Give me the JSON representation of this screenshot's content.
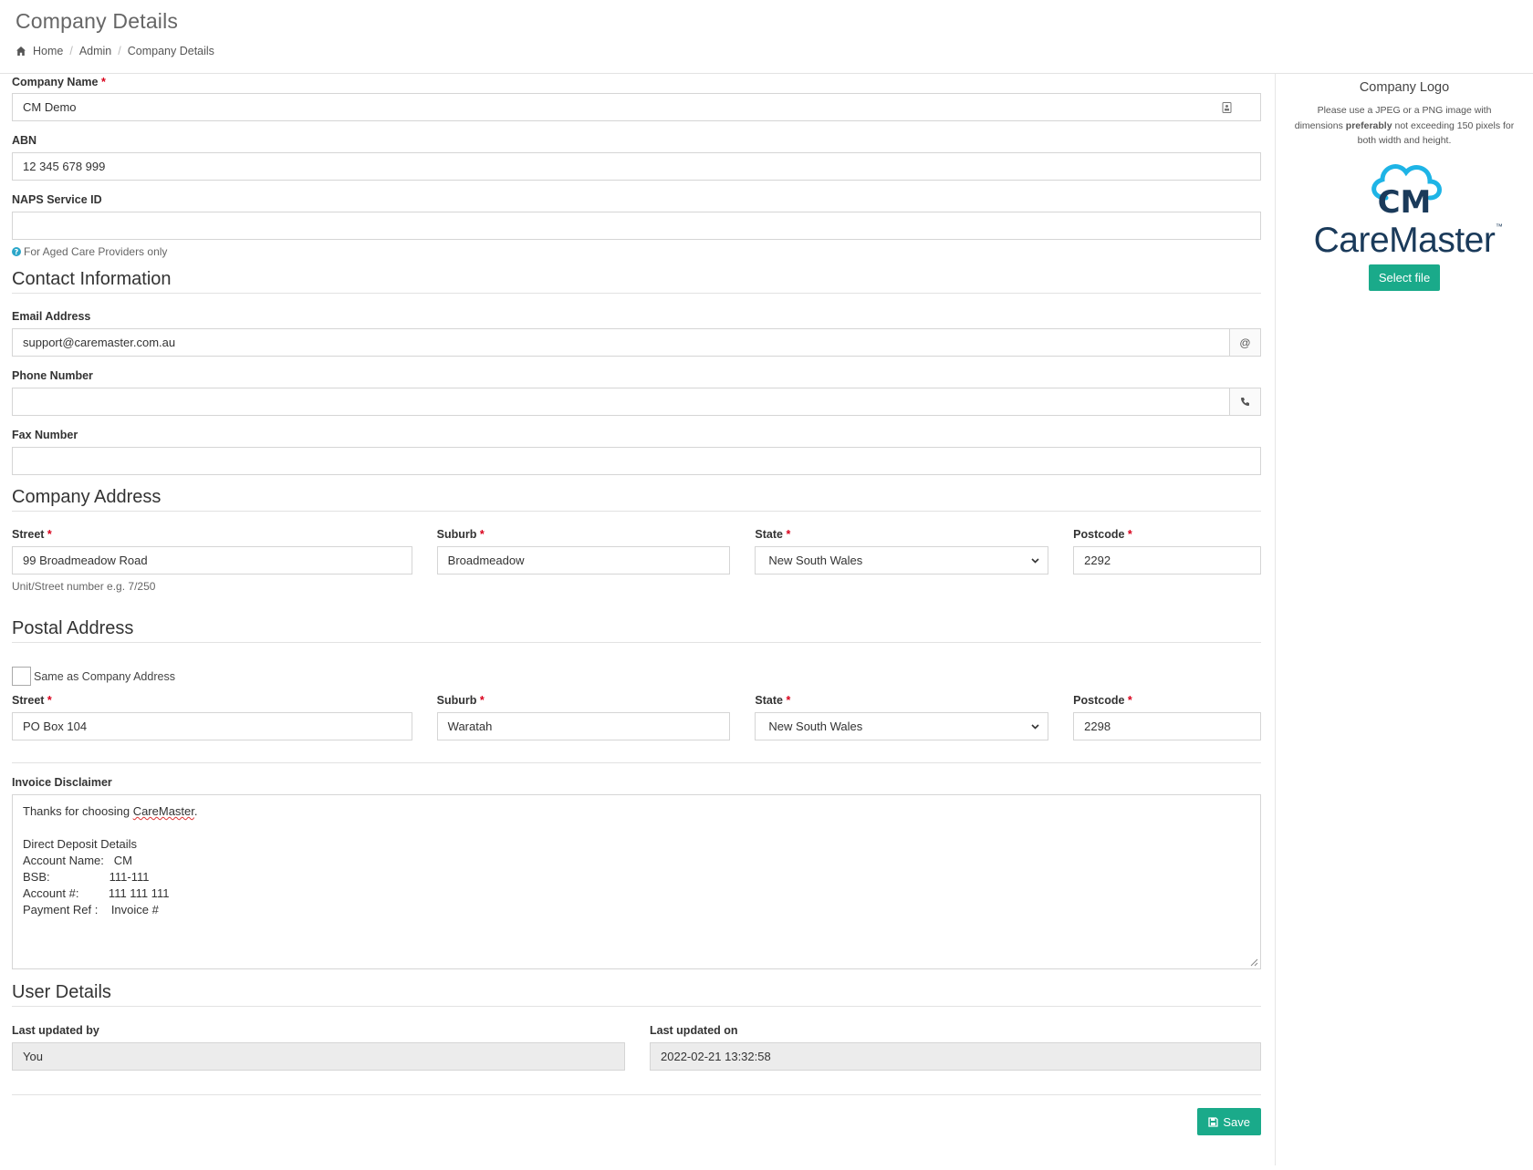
{
  "header": {
    "title": "Company Details",
    "breadcrumb": {
      "home": "Home",
      "admin": "Admin",
      "current": "Company Details",
      "sep": "/"
    }
  },
  "company": {
    "name_label": "Company Name",
    "name_value": "CM Demo",
    "abn_label": "ABN",
    "abn_value": "12 345 678 999",
    "naps_label": "NAPS Service ID",
    "naps_value": "",
    "naps_help": "For Aged Care Providers only"
  },
  "contact": {
    "section_title": "Contact Information",
    "email_label": "Email Address",
    "email_value": "support@caremaster.com.au",
    "email_addon": "@",
    "phone_label": "Phone Number",
    "phone_value": "",
    "fax_label": "Fax Number",
    "fax_value": ""
  },
  "company_address": {
    "section_title": "Company Address",
    "street_label": "Street",
    "street_value": "99 Broadmeadow Road",
    "street_help": "Unit/Street number e.g. 7/250",
    "suburb_label": "Suburb",
    "suburb_value": "Broadmeadow",
    "state_label": "State",
    "state_value": "New South Wales",
    "postcode_label": "Postcode",
    "postcode_value": "2292"
  },
  "postal_address": {
    "section_title": "Postal Address",
    "same_as_label": "Same as Company Address",
    "street_label": "Street",
    "street_value": "PO Box 104",
    "suburb_label": "Suburb",
    "suburb_value": "Waratah",
    "state_label": "State",
    "state_value": "New South Wales",
    "postcode_label": "Postcode",
    "postcode_value": "2298"
  },
  "invoice": {
    "label": "Invoice Disclaimer",
    "line1_pre": "Thanks for choosing ",
    "line1_brand": "CareMaster",
    "line1_post": ".",
    "line3": "Direct Deposit Details",
    "line4": "Account Name:   CM",
    "line5": "BSB:                  111-111",
    "line6": "Account #:         111 111 111",
    "line7": "Payment Ref :    Invoice #"
  },
  "user_details": {
    "section_title": "User Details",
    "updated_by_label": "Last updated by",
    "updated_by_value": "You",
    "updated_on_label": "Last updated on",
    "updated_on_value": "2022-02-21 13:32:58"
  },
  "actions": {
    "save_label": "Save"
  },
  "logo_panel": {
    "title": "Company Logo",
    "desc_1": "Please use a JPEG or a PNG image with dimensions",
    "desc_bold": "preferably",
    "desc_2": "not exceeding 150 pixels for both width and height.",
    "logo_mark": "CM",
    "logo_word": "CareMaster",
    "logo_tm": "™",
    "select_label": "Select file"
  },
  "required_mark": "*",
  "colors": {
    "accent": "#1aaa8a",
    "required": "#d9001b",
    "logo_navy": "#1a3a5a",
    "logo_cyan": "#1eb4e6"
  }
}
